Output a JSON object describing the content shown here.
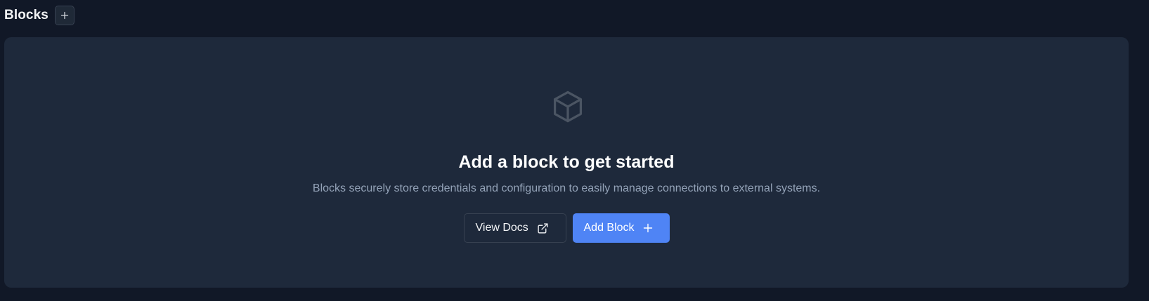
{
  "header": {
    "title": "Blocks",
    "add_icon": "plus-icon"
  },
  "empty_state": {
    "icon": "cube-icon",
    "title": "Add a block to get started",
    "description": "Blocks securely store credentials and configuration to easily manage connections to external systems.",
    "view_docs": {
      "label": "View Docs",
      "icon": "external-link-icon"
    },
    "add_block": {
      "label": "Add Block",
      "icon": "plus-icon"
    }
  },
  "colors": {
    "background": "#111827",
    "card": "#1e293b",
    "primary": "#4f84f5",
    "muted_text": "#94a3b8"
  }
}
